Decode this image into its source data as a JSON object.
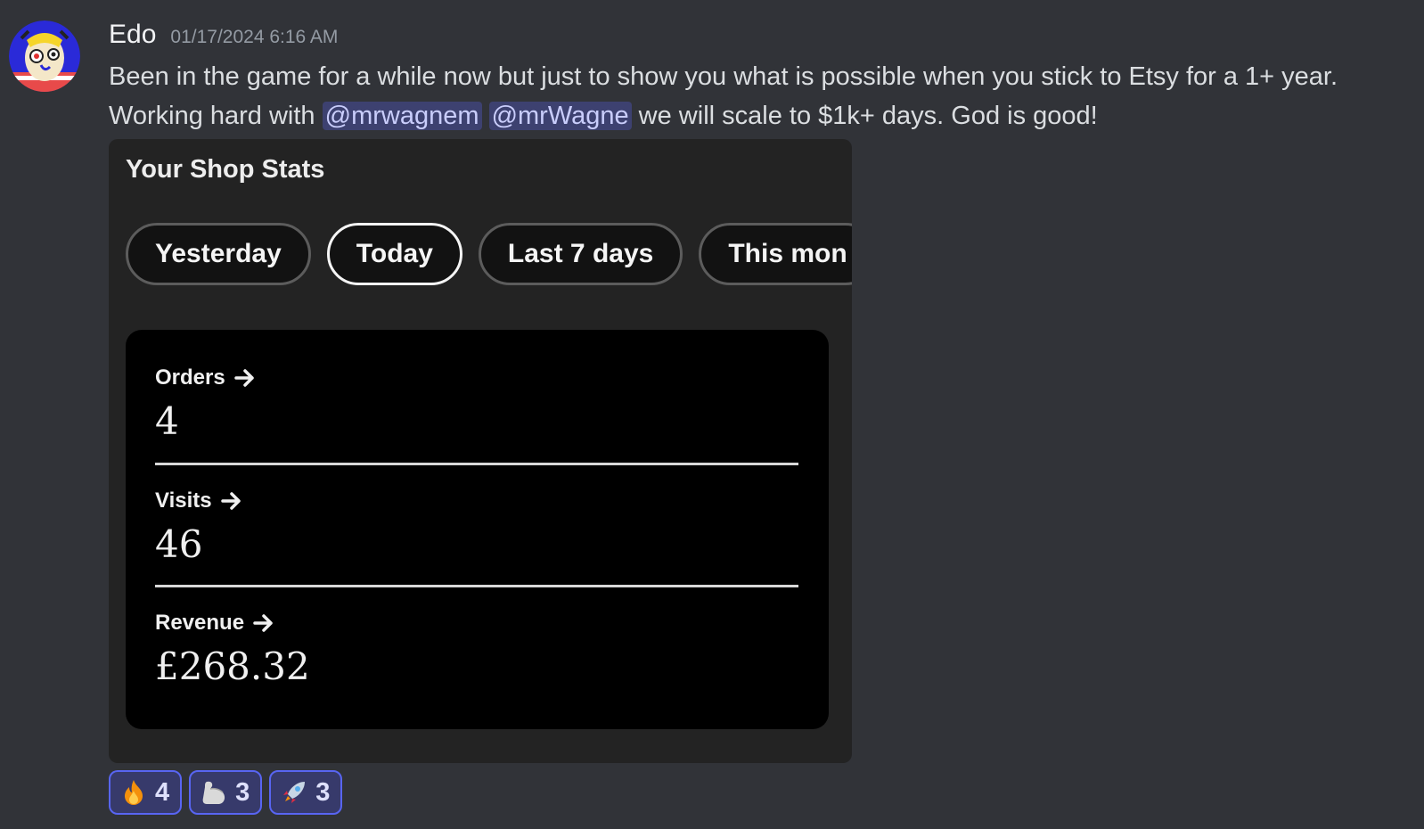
{
  "message": {
    "author": "Edo",
    "timestamp": "01/17/2024 6:16 AM",
    "text_line1": "Been in the game for a while now but just to show you what is possible when you stick to Etsy for a 1+ year.",
    "text_line2_before": "Working hard with ",
    "mention1": "@mrwagnem",
    "mention2": "@mrWagne",
    "text_line2_after": " we will scale to $1k+ days. God is good!"
  },
  "attachment": {
    "title": "Your Shop Stats",
    "pills": [
      "Yesterday",
      "Today",
      "Last 7 days",
      "This mon"
    ],
    "active_pill": "Today",
    "stats": [
      {
        "label": "Orders",
        "value": "4",
        "icon": "arrow-right-icon"
      },
      {
        "label": "Visits",
        "value": "46",
        "icon": "arrow-right-icon"
      },
      {
        "label": "Revenue",
        "value": "£268.32",
        "icon": "arrow-right-icon"
      }
    ]
  },
  "reactions": [
    {
      "emoji": "fire-icon",
      "count": "4"
    },
    {
      "emoji": "flexed-biceps-icon",
      "count": "3"
    },
    {
      "emoji": "rocket-icon",
      "count": "3"
    }
  ],
  "colors": {
    "background": "#313338",
    "mention_bg": "#3c4270",
    "reaction_border": "#5865f2",
    "reaction_bg": "#373a6b"
  }
}
